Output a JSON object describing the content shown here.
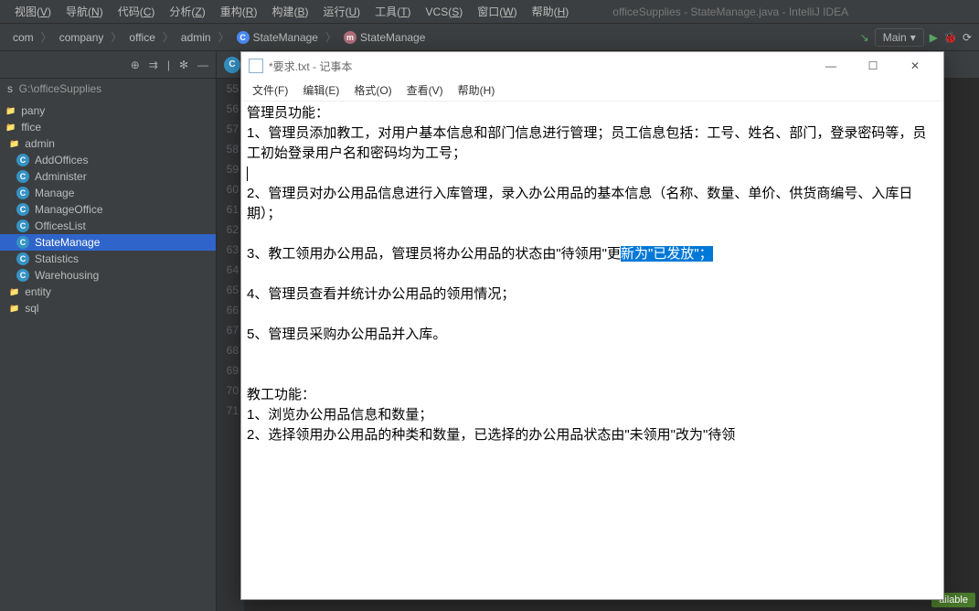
{
  "window": {
    "title": "officeSupplies - StateManage.java - IntelliJ IDEA"
  },
  "menubar": {
    "items": [
      {
        "label": "视图",
        "accel": "V"
      },
      {
        "label": "导航",
        "accel": "N"
      },
      {
        "label": "代码",
        "accel": "C"
      },
      {
        "label": "分析",
        "accel": "Z"
      },
      {
        "label": "重构",
        "accel": "R"
      },
      {
        "label": "构建",
        "accel": "B"
      },
      {
        "label": "运行",
        "accel": "U"
      },
      {
        "label": "工具",
        "accel": "T"
      },
      {
        "label": "VCS",
        "accel": "S"
      },
      {
        "label": "窗口",
        "accel": "W"
      },
      {
        "label": "帮助",
        "accel": "H"
      }
    ]
  },
  "breadcrumb": {
    "items": [
      {
        "label": "com",
        "icon": null
      },
      {
        "label": "company",
        "icon": null
      },
      {
        "label": "office",
        "icon": null
      },
      {
        "label": "admin",
        "icon": null
      },
      {
        "label": "StateManage",
        "icon": "class"
      },
      {
        "label": "StateManage",
        "icon": "method"
      }
    ]
  },
  "run": {
    "config": "Main"
  },
  "project": {
    "root": "G:\\officeSupplies",
    "tree": [
      {
        "label": "pany",
        "type": "folder",
        "depth": 1
      },
      {
        "label": "ffice",
        "type": "folder",
        "depth": 1
      },
      {
        "label": "admin",
        "type": "folder",
        "depth": 2
      },
      {
        "label": "AddOffices",
        "type": "class",
        "depth": 3
      },
      {
        "label": "Administer",
        "type": "class",
        "depth": 3
      },
      {
        "label": "Manage",
        "type": "class",
        "depth": 3
      },
      {
        "label": "ManageOffice",
        "type": "class",
        "depth": 3
      },
      {
        "label": "OfficesList",
        "type": "class",
        "depth": 3
      },
      {
        "label": "StateManage",
        "type": "class",
        "depth": 3,
        "selected": true
      },
      {
        "label": "Statistics",
        "type": "class",
        "depth": 3
      },
      {
        "label": "Warehousing",
        "type": "class",
        "depth": 3
      },
      {
        "label": "entity",
        "type": "folder",
        "depth": 2
      },
      {
        "label": "sql",
        "type": "folder",
        "depth": 2
      }
    ]
  },
  "editor": {
    "gutter_start": 55,
    "gutter_lines": [
      "55",
      "56",
      "57",
      "58",
      "59",
      "60",
      "61",
      "62",
      "63",
      "64",
      "65",
      "66",
      "67",
      "68",
      "69",
      "70",
      "71"
    ]
  },
  "status": {
    "right": "ailable"
  },
  "notepad": {
    "title": "*要求.txt - 记事本",
    "menu": {
      "items": [
        {
          "label": "文件(F)"
        },
        {
          "label": "编辑(E)"
        },
        {
          "label": "格式(O)"
        },
        {
          "label": "查看(V)"
        },
        {
          "label": "帮助(H)"
        }
      ]
    },
    "content": {
      "lines": [
        "管理员功能：",
        "1、管理员添加教工，对用户基本信息和部门信息进行管理；员工信息包括：工号、姓名、部门，登录密码等，员工初始登录用户名和密码均为工号；",
        "",
        "2、管理员对办公用品信息进行入库管理，录入办公用品的基本信息（名称、数量、单价、供货商编号、入库日期）；",
        "",
        "3、教工领用办公用品，管理员将办公用品的状态由\"待领用\"更",
        "",
        "4、管理员查看并统计办公用品的领用情况；",
        "",
        "5、管理员采购办公用品并入库。",
        "",
        "",
        "教工功能：",
        "1、浏览办公用品信息和数量；",
        "2、选择领用办公用品的种类和数量，已选择的办公用品状态由\"未领用\"改为\"待领"
      ],
      "selection_suffix": "新为\"已发放\"；",
      "selection_line_index": 5
    }
  }
}
